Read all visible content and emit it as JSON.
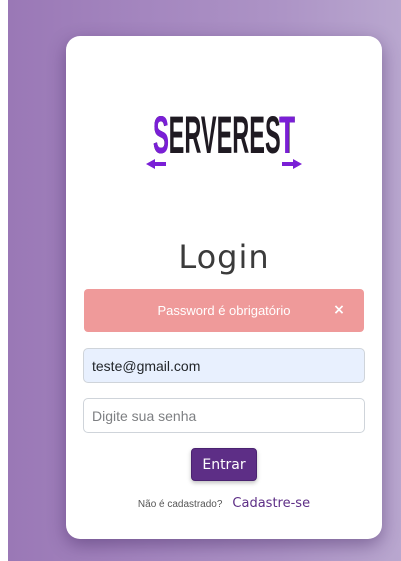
{
  "logo": {
    "text": "SERVEREST",
    "colors": {
      "dark": "#1f1a22",
      "accent": "#7a1fd6"
    }
  },
  "page_title": "Login",
  "alert": {
    "message": "Password é obrigatório",
    "close_label": "×",
    "color": "#ef9a9a"
  },
  "form": {
    "email_value": "teste@gmail.com",
    "password_placeholder": "Digite sua senha",
    "submit_label": "Entrar"
  },
  "signup": {
    "question": "Não é cadastrado?",
    "link_label": "Cadastre-se"
  },
  "colors": {
    "brand": "#5d2e86",
    "background": "#a486bf"
  }
}
